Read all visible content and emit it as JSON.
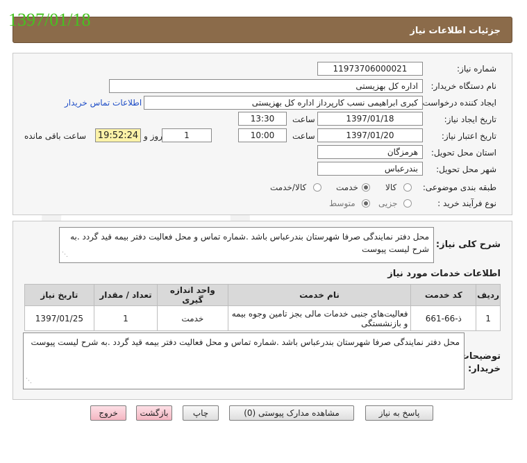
{
  "stamp_date": "1397/01/18",
  "header": {
    "title": "جزئیات اطلاعات نیاز"
  },
  "form": {
    "need_number": {
      "label": "شماره نیاز:",
      "value": "11973706000021"
    },
    "buyer_org": {
      "label": "نام دستگاه خریدار:",
      "value": "اداره کل بهزیستی"
    },
    "requester": {
      "label": "ایجاد کننده درخواست:",
      "value": "کبری  ابراهیمی نسب کارپرداز اداره کل بهزیستی",
      "contact_link": "اطلاعات تماس خریدار"
    },
    "created": {
      "label": "تاریخ ایجاد نیاز:",
      "date": "1397/01/18",
      "time_label": "ساعت",
      "time": "13:30"
    },
    "valid": {
      "label": "تاریخ اعتبار نیاز:",
      "date": "1397/01/20",
      "time_label": "ساعت",
      "time": "10:00",
      "days": "1",
      "days_label": "روز و",
      "remaining": "19:52:24",
      "remaining_label": "ساعت باقی مانده"
    },
    "province": {
      "label": "استان محل تحویل:",
      "value": "هرمزگان"
    },
    "city": {
      "label": "شهر محل تحویل:",
      "value": "بندرعباس"
    },
    "category": {
      "label": "طبقه بندی موضوعی:",
      "options": [
        "کالا",
        "خدمت",
        "کالا/خدمت"
      ],
      "selected": "خدمت"
    },
    "process": {
      "label": "نوع فرآیند خرید :",
      "options": [
        "جزیی",
        "متوسط"
      ],
      "selected": "متوسط"
    }
  },
  "summary": {
    "label": "شرح کلی نیاز:",
    "text": "محل دفتر نمایندگی صرفا شهرستان بندرعباس باشد .شماره تماس و محل فعالیت دفتر بیمه قید گردد .به شرح لیست پیوست"
  },
  "services": {
    "title": "اطلاعات خدمات مورد نیاز",
    "columns": [
      "ردیف",
      "کد خدمت",
      "نام خدمت",
      "واحد اندازه گیری",
      "تعداد / مقدار",
      "تاریخ نیاز"
    ],
    "rows": [
      [
        "1",
        "ذ-66-661",
        "فعالیت‌های جنبی خدمات مالی بجز تامین وجوه بیمه و بازنشستگی",
        "خدمت",
        "1",
        "1397/01/25"
      ]
    ]
  },
  "buyer_notes": {
    "label": "توضیحات خریدار:",
    "text": "محل دفتر نمایندگی صرفا شهرستان بندرعباس باشد .شماره تماس و محل فعالیت دفتر بیمه قید گردد .به شرح لیست پیوست"
  },
  "buttons": {
    "reply": "پاسخ به نیاز",
    "attachments": "مشاهده مدارک پیوستی (0)",
    "print": "چاپ",
    "back": "بازگشت",
    "exit": "خروج"
  }
}
